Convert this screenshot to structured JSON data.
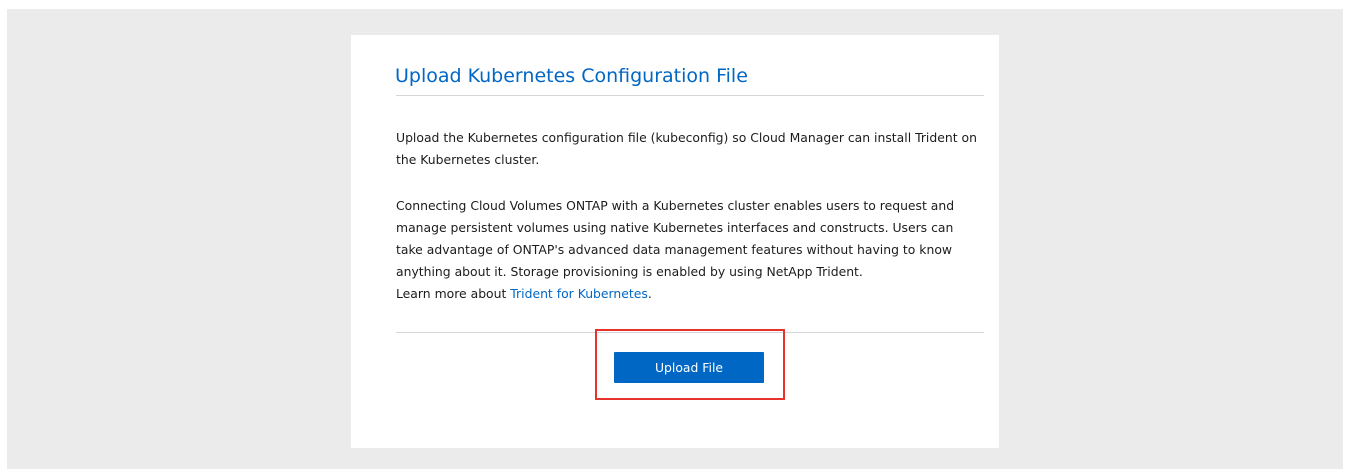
{
  "dialog": {
    "title": "Upload Kubernetes Configuration File",
    "paragraph1": "Upload the Kubernetes configuration file (kubeconfig) so Cloud Manager can install Trident on the Kubernetes cluster.",
    "paragraph2": "Connecting Cloud Volumes ONTAP with a Kubernetes cluster enables users to request and manage persistent volumes using native Kubernetes interfaces and constructs. Users can take advantage of ONTAP's advanced data management features without having to know anything about it. Storage provisioning is enabled by using NetApp Trident.",
    "learn_more_prefix": "Learn more about ",
    "learn_more_link": "Trident for Kubernetes",
    "learn_more_suffix": ".",
    "upload_button_label": "Upload File"
  },
  "colors": {
    "accent": "#0067c5",
    "highlight": "#e8322d",
    "backdrop": "#ebebeb"
  }
}
